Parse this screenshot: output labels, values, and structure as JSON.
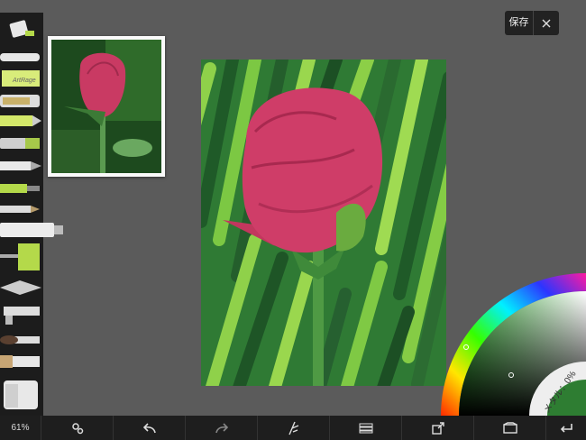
{
  "toolbar_top": {
    "save_label": "保存"
  },
  "color_picker": {
    "metallic_label": "メタル：0%",
    "selected_color": "#2e7d32"
  },
  "bottom_bar": {
    "zoom_label": "61%",
    "items": [
      {
        "name": "settings-icon"
      },
      {
        "name": "undo-icon"
      },
      {
        "name": "redo-icon"
      },
      {
        "name": "tracing-icon"
      },
      {
        "name": "layers-icon"
      },
      {
        "name": "share-icon"
      },
      {
        "name": "gallery-icon"
      },
      {
        "name": "back-icon"
      }
    ]
  },
  "tools": [
    {
      "name": "paint-bucket-tool"
    },
    {
      "name": "eraser-tool"
    },
    {
      "name": "sticker-tool"
    },
    {
      "name": "gloop-pen-tool"
    },
    {
      "name": "glitter-tool"
    },
    {
      "name": "felt-marker-tool"
    },
    {
      "name": "ink-pen-tool"
    },
    {
      "name": "technical-pen-tool"
    },
    {
      "name": "pencil-tool"
    },
    {
      "name": "oil-paint-tube-tool"
    },
    {
      "name": "paint-roller-tool"
    },
    {
      "name": "palette-knife-tool"
    },
    {
      "name": "airbrush-tool"
    },
    {
      "name": "watercolor-brush-tool"
    },
    {
      "name": "oil-brush-tool"
    },
    {
      "name": "color-picker-tool"
    }
  ],
  "colors": {
    "accent_green": "#b4d94a",
    "canvas_bg": "#ffffff",
    "app_bg": "#5b5b5b"
  }
}
